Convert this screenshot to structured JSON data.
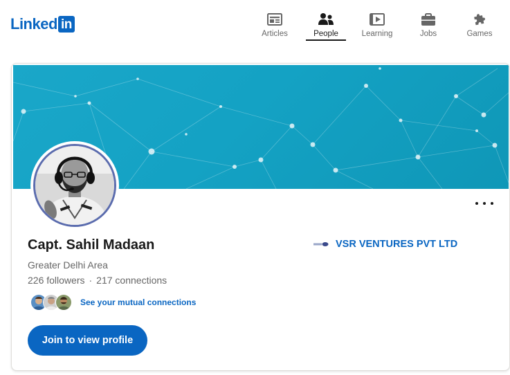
{
  "header": {
    "logo_text": "Linked",
    "logo_box": "in",
    "brand_color": "#0a66c2",
    "nav": [
      {
        "label": "Articles",
        "icon": "articles-icon",
        "active": false
      },
      {
        "label": "People",
        "icon": "people-icon",
        "active": true
      },
      {
        "label": "Learning",
        "icon": "learning-icon",
        "active": false
      },
      {
        "label": "Jobs",
        "icon": "jobs-icon",
        "active": false
      },
      {
        "label": "Games",
        "icon": "puzzle-icon",
        "active": false
      }
    ]
  },
  "profile": {
    "name": "Capt. Sahil Madaan",
    "location": "Greater Delhi Area",
    "followers": "226 followers",
    "separator": "·",
    "connections": "217 connections",
    "mutual_link": "See your mutual connections",
    "join_button": "Join to view profile",
    "company_name": "VSR VENTURES PVT LTD",
    "banner_color": "#14a2c4",
    "avatar_ring_color": "#5b6cae"
  }
}
